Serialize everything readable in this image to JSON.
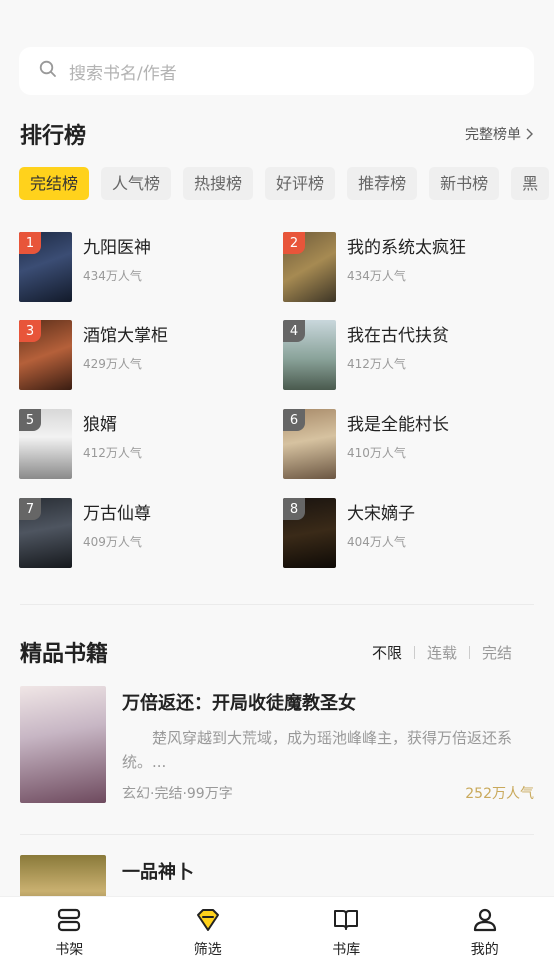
{
  "search": {
    "placeholder": "搜索书名/作者"
  },
  "ranking": {
    "title": "排行榜",
    "more": "完整榜单",
    "tabs": [
      "完结榜",
      "人气榜",
      "热搜榜",
      "好评榜",
      "推荐榜",
      "新书榜",
      "黑"
    ],
    "items": [
      {
        "rank": "1",
        "name": "九阳医神",
        "pop": "434万人气"
      },
      {
        "rank": "2",
        "name": "我的系统太疯狂",
        "pop": "434万人气"
      },
      {
        "rank": "3",
        "name": "酒馆大掌柜",
        "pop": "429万人气"
      },
      {
        "rank": "4",
        "name": "我在古代扶贫",
        "pop": "412万人气"
      },
      {
        "rank": "5",
        "name": "狼婿",
        "pop": "412万人气"
      },
      {
        "rank": "6",
        "name": "我是全能村长",
        "pop": "410万人气"
      },
      {
        "rank": "7",
        "name": "万古仙尊",
        "pop": "409万人气"
      },
      {
        "rank": "8",
        "name": "大宋嫡子",
        "pop": "404万人气"
      }
    ]
  },
  "premium": {
    "title": "精品书籍",
    "filters": [
      "不限",
      "连载",
      "完结"
    ],
    "books": [
      {
        "title": "万倍返还：开局收徒魔教圣女",
        "desc": "楚风穿越到大荒域，成为瑶池峰峰主，获得万倍返还系统。...",
        "meta": "玄幻·完结·99万字",
        "pop": "252万人气"
      },
      {
        "title": "一品神卜"
      }
    ]
  },
  "nav": [
    {
      "label": "书架",
      "icon": "bookshelf-icon"
    },
    {
      "label": "筛选",
      "icon": "diamond-icon"
    },
    {
      "label": "书库",
      "icon": "open-book-icon"
    },
    {
      "label": "我的",
      "icon": "person-icon"
    }
  ],
  "colors": {
    "accent": "#ffd21c",
    "popularity": "#c9a95b",
    "badge_top3": "#e8553a",
    "badge_other": "#666666"
  }
}
